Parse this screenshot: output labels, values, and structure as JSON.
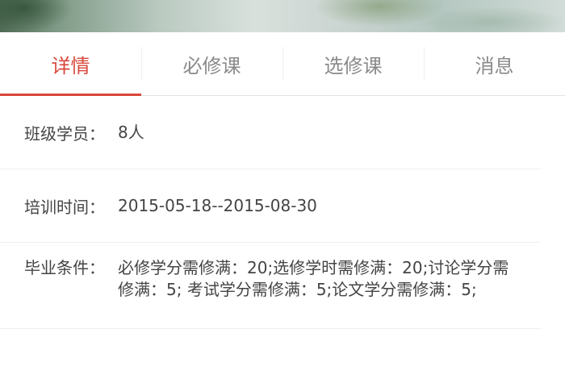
{
  "tabs": [
    {
      "label": "详情",
      "active": true
    },
    {
      "label": "必修课",
      "active": false
    },
    {
      "label": "选修课",
      "active": false
    },
    {
      "label": "消息",
      "active": false
    }
  ],
  "details": {
    "members_label": "班级学员：",
    "members_value": "8人",
    "period_label": "培训时间：",
    "period_value": "2015-05-18--2015-08-30",
    "graduation_label": "毕业条件：",
    "graduation_value": "必修学分需修满：20;选修学时需修满：20;讨论学分需修满：5; 考试学分需修满：5;论文学分需修满：5;"
  },
  "colors": {
    "accent": "#d9473b",
    "tab_inactive": "#8a8a8a",
    "text": "#444444",
    "divider": "#efefef"
  }
}
